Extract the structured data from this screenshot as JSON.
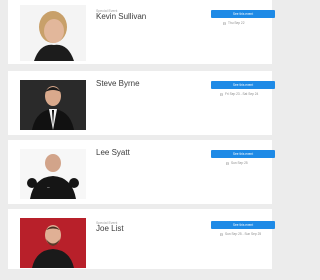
{
  "comedians": [
    {
      "tag": "Special Event",
      "name": "Kevin Sullivan",
      "button": "See this event",
      "dates": "Thu Sep 22"
    },
    {
      "tag": "",
      "name": "Steve Byrne",
      "button": "See this event",
      "dates": "Fri Sep 23 - Sat Sep 24"
    },
    {
      "tag": "",
      "name": "Lee Syatt",
      "button": "See this event",
      "dates": "Sun Sep 25"
    },
    {
      "tag": "Special Event",
      "name": "Joe List",
      "button": "See this event",
      "dates": "Sun Sep 25 - Sun Sep 25"
    }
  ],
  "colors": {
    "accent": "#1e8ae6",
    "background": "#ececec"
  },
  "icons": {
    "date": "calendar-icon"
  }
}
